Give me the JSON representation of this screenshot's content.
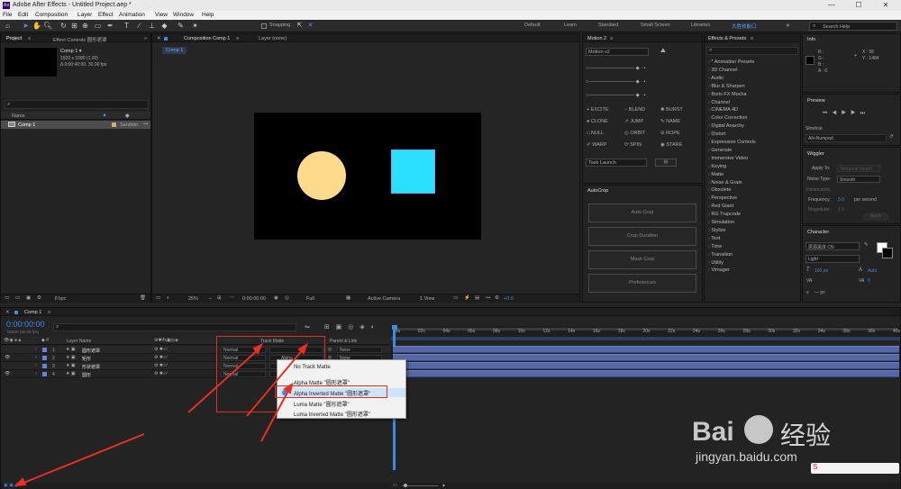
{
  "titlebar": {
    "title": "Adobe After Effects - Untitled Project.aep *",
    "logo": "Ae",
    "min": "—",
    "max": "☐",
    "close": "✕"
  },
  "menubar": {
    "items": [
      "File",
      "Edit",
      "Composition",
      "Layer",
      "Effect",
      "Animation",
      "View",
      "Window",
      "Help"
    ]
  },
  "toolbar": {
    "snapping": "Snapping",
    "workspaces": [
      "Default",
      "Learn",
      "Standard",
      "Small Screen",
      "Libraries",
      "大胜技能口"
    ],
    "search_placeholder": "Search Help"
  },
  "project": {
    "tab_project": "Project",
    "tab_effect_controls": "Effect Controls 圆形遮罩",
    "comp_name": "Comp 1 ▾",
    "comp_info1": "1920 x 1080 (1.00)",
    "comp_info2": "Δ 0:00:40:00, 30.00 fps",
    "col_name": "Name",
    "item_name": "Comp 1",
    "item_status": "Sandsto",
    "bpc": "8 bpc"
  },
  "composition": {
    "tab_label": "Composition Comp 1",
    "layer_tab": "Layer (none)",
    "breadcrumb": "Comp 1",
    "zoom": "25%",
    "time": "0:00:00:00",
    "quality": "Full",
    "camera": "Active Camera",
    "view": "1 View",
    "exposure": "+0.0",
    "colors": {
      "circle": "#ffd98c",
      "square": "#2be0ff",
      "canvas": "#000000"
    }
  },
  "motion2": {
    "title": "Motion 2",
    "version": "Motion v2",
    "tools": [
      "EXCITE",
      "BLEND",
      "BURST",
      "CLONE",
      "JUMP",
      "NAME",
      "NULL",
      "ORBIT",
      "ROPE",
      "WARP",
      "SPIN",
      "STARE"
    ],
    "task": "Task Launch"
  },
  "autocrop": {
    "title": "AutoCrop",
    "buttons": [
      "Auto Crop",
      "Crop Duration",
      "Mask Crop",
      "Preferences"
    ]
  },
  "effects": {
    "title": "Effects & Presets",
    "items": [
      "* Animation Presets",
      "3D Channel",
      "Audio",
      "Blur & Sharpen",
      "Boris FX Mocha",
      "Channel",
      "CINEMA 4D",
      "Color Correction",
      "Digital Anarchy",
      "Distort",
      "Expression Controls",
      "Generate",
      "Immersive Video",
      "Keying",
      "Matte",
      "Noise & Grain",
      "Obsolete",
      "Perspective",
      "Red Giant",
      "RG Trapcode",
      "Simulation",
      "Stylize",
      "Text",
      "Time",
      "Transition",
      "Utility",
      "Vimager"
    ]
  },
  "info": {
    "title": "Info",
    "r": "R :",
    "g": "G :",
    "b": "B :",
    "a": "A : 0",
    "x": "X : 56",
    "y": "Y : 1484"
  },
  "preview": {
    "title": "Preview",
    "shortcut_label": "Shortcut",
    "shortcut": "Alt+Numpad ."
  },
  "wiggler": {
    "title": "Wiggler",
    "apply_to_label": "Apply To:",
    "apply_to": "Temporal Graph",
    "noise_label": "Noise Type:",
    "noise": "Smooth",
    "dimensions_label": "Dimensions:",
    "freq_label": "Frequency:",
    "freq": "5.0",
    "freq_unit": "per second",
    "mag_label": "Magnitude:",
    "mag": "1.0",
    "apply_btn": "Apply"
  },
  "character": {
    "title": "Character",
    "font": "思源黑体 CN",
    "style": "Light",
    "size": "100 px",
    "leading": "Auto",
    "tracking": "0",
    "unit": "px",
    "unit2": "— px"
  },
  "timeline": {
    "tab": "Comp 1",
    "timecode": "0:00:00:00",
    "timecode_sub": "00000 (30.00 fps)",
    "col_layer_name": "Layer Name",
    "col_track_matte": "Track Matte",
    "col_parent": "Parent & Link",
    "rulers": [
      "00s",
      "02s",
      "04s",
      "06s",
      "08s",
      "10s",
      "12s",
      "14s",
      "16s",
      "18s",
      "20s",
      "22s",
      "24s",
      "26s",
      "28s",
      "30s",
      "32s",
      "34s",
      "36s",
      "38s",
      "40s"
    ],
    "layers": [
      {
        "num": "1",
        "name": "圆形遮罩",
        "mode": "Normal",
        "matte": "",
        "parent": "None",
        "color": "#6a80e0"
      },
      {
        "num": "2",
        "name": "矩形",
        "mode": "Normal",
        "matte": "",
        "parent": "None",
        "color": "#6a80e0"
      },
      {
        "num": "3",
        "name": "形状遮罩",
        "mode": "Normal",
        "matte": "",
        "parent": "None",
        "color": "#6a80e0"
      },
      {
        "num": "4",
        "name": "圆形",
        "mode": "Normal",
        "matte": "",
        "parent": "None",
        "color": "#6a80e0"
      }
    ],
    "matte_value": "Alpha",
    "footer": "Toggle Switches / Modes"
  },
  "matte_menu": {
    "items": [
      "No Track Matte",
      "Alpha Matte \"圆形遮罩\"",
      "Alpha Inverted Matte \"圆形遮罩\"",
      "Luma Matte \"圆形遮罩\"",
      "Luma Inverted Matte \"圆形遮罩\""
    ],
    "selected_index": 2
  },
  "watermark": {
    "brand": "Bai",
    "brand2": "经验",
    "url": "jingyan.baidu.com"
  }
}
